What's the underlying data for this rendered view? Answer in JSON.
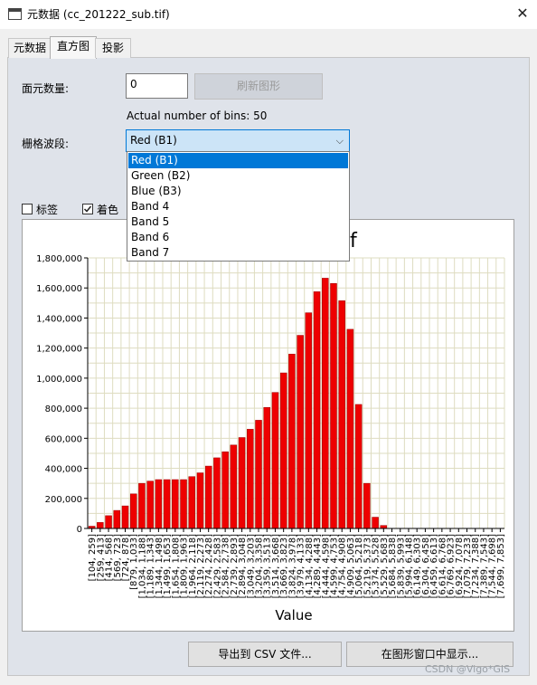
{
  "window": {
    "title": "元数据 (cc_201222_sub.tif)",
    "close_glyph": "✕"
  },
  "tabs": [
    {
      "label": "元数据",
      "active": false
    },
    {
      "label": "直方图",
      "active": true
    },
    {
      "label": "投影",
      "active": false
    }
  ],
  "form": {
    "count_label": "面元数量:",
    "count_value": "0",
    "refresh_label": "刷新图形",
    "bins_info": "Actual number of bins: 50",
    "band_label": "栅格波段:",
    "band_selected": "Red (B1)",
    "band_options": [
      "Red (B1)",
      "Green (B2)",
      "Blue (B3)",
      "Band 4",
      "Band 5",
      "Band 6",
      "Band 7"
    ],
    "labels_checkbox": "标签",
    "labels_checked": false,
    "color_checkbox": "着色",
    "color_checked": true
  },
  "buttons": {
    "export_csv": "导出到 CSV 文件...",
    "show_in_window": "在图形窗口中显示..."
  },
  "watermark": "CSDN @Vigo*GIS",
  "colors": {
    "bar": "#ee0000",
    "bar_stroke": "#990000",
    "grid": "#dedcc0",
    "accent": "#0078d7"
  },
  "chart_data": {
    "type": "bar",
    "title": "f",
    "xlabel": "Value",
    "ylabel": "",
    "ylim": [
      0,
      1800000
    ],
    "yticks": [
      "0",
      "200,000",
      "400,000",
      "600,000",
      "800,000",
      "1,000,000",
      "1,200,000",
      "1,400,000",
      "1,600,000",
      "1,800,000"
    ],
    "grid": true,
    "categories": [
      "[104, 259]",
      "[259, 413]",
      "[414, 568]",
      "[569, 723]",
      "[724, 878]",
      "[879, 1,033]",
      "[1,034, 1,188]",
      "[1,189, 1,343]",
      "[1,344, 1,498]",
      "[1,499, 1,653]",
      "[1,654, 1,808]",
      "[1,809, 1,963]",
      "[1,964, 2,118]",
      "[2,119, 2,273]",
      "[2,274, 2,428]",
      "[2,429, 2,583]",
      "[2,584, 2,738]",
      "[2,739, 2,893]",
      "[2,894, 3,048]",
      "[3,049, 3,203]",
      "[3,204, 3,358]",
      "[3,359, 3,513]",
      "[3,514, 3,668]",
      "[3,669, 3,823]",
      "[3,824, 3,978]",
      "[3,979, 4,133]",
      "[4,134, 4,288]",
      "[4,289, 4,443]",
      "[4,444, 4,598]",
      "[4,599, 4,753]",
      "[4,754, 4,908]",
      "[4,909, 5,063]",
      "[5,064, 5,218]",
      "[5,219, 5,373]",
      "[5,374, 5,528]",
      "[5,529, 5,683]",
      "[5,684, 5,838]",
      "[5,839, 5,993]",
      "[5,994, 6,148]",
      "[6,149, 6,303]",
      "[6,304, 6,458]",
      "[6,459, 6,613]",
      "[6,614, 6,768]",
      "[6,769, 6,923]",
      "[6,924, 7,078]",
      "[7,079, 7,233]",
      "[7,234, 7,388]",
      "[7,389, 7,543]",
      "[7,544, 7,698]",
      "[7,699, 7,853]"
    ],
    "values": [
      15000,
      40000,
      85000,
      120000,
      150000,
      230000,
      300000,
      315000,
      325000,
      325000,
      325000,
      325000,
      345000,
      370000,
      415000,
      470000,
      510000,
      555000,
      605000,
      660000,
      720000,
      805000,
      905000,
      1035000,
      1160000,
      1285000,
      1435000,
      1575000,
      1665000,
      1630000,
      1515000,
      1325000,
      825000,
      300000,
      75000,
      20000,
      0,
      0,
      0,
      0,
      0,
      0,
      0,
      0,
      0,
      0,
      0,
      0,
      0,
      0
    ]
  }
}
